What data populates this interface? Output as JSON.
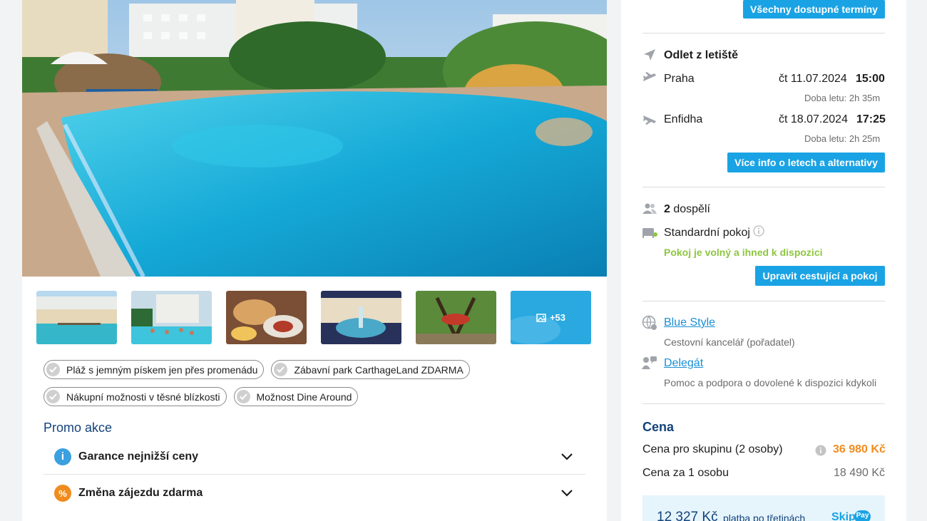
{
  "tags": [
    "Pláž s jemným pískem jen přes promenádu",
    "Zábavní park CarthageLand ZDARMA",
    "Nákupní možnosti v těsné blízkosti",
    "Možnost Dine Around"
  ],
  "gallery": {
    "more_count": "+53"
  },
  "promo": {
    "title": "Promo akce",
    "items": [
      "Garance nejnižší ceny",
      "Změna zájezdu zdarma"
    ]
  },
  "terms": {
    "all_terms_button": "Všechny dostupné termíny"
  },
  "flights": {
    "header": "Odlet z letiště",
    "outbound": {
      "city": "Praha",
      "date": "čt 11.07.2024",
      "time": "15:00",
      "duration": "Doba letu: 2h 35m"
    },
    "inbound": {
      "city": "Enfidha",
      "date": "čt 18.07.2024",
      "time": "17:25",
      "duration": "Doba letu: 2h 25m"
    },
    "more_button": "Více info o letech a alternativy"
  },
  "travellers": {
    "count": "2",
    "label": "dospělí",
    "room": "Standardní pokoj",
    "availability": "Pokoj je volný a ihned k dispozici",
    "edit_button": "Upravit cestující a pokoj"
  },
  "organizer": {
    "name": "Blue Style",
    "desc": "Cestovní kancelář (pořadatel)",
    "delegate": "Delegát",
    "delegate_desc": "Pomoc a podpora o dovolené k dispozici kdykoli"
  },
  "price": {
    "title": "Cena",
    "group_label": "Cena pro skupinu (2 osoby)",
    "group_value": "36 980 Kč",
    "per_person_label": "Cena za 1 osobu",
    "per_person_value": "18 490 Kč"
  },
  "skippay": {
    "amount": "12 327 Kč",
    "text": "platba po třetinách",
    "logo": "Skip",
    "logo_badge": "Pay"
  },
  "colors": {
    "accent": "#1aa3e4",
    "navy": "#13437a",
    "price": "#f08c1e",
    "green": "#8dc63f"
  }
}
